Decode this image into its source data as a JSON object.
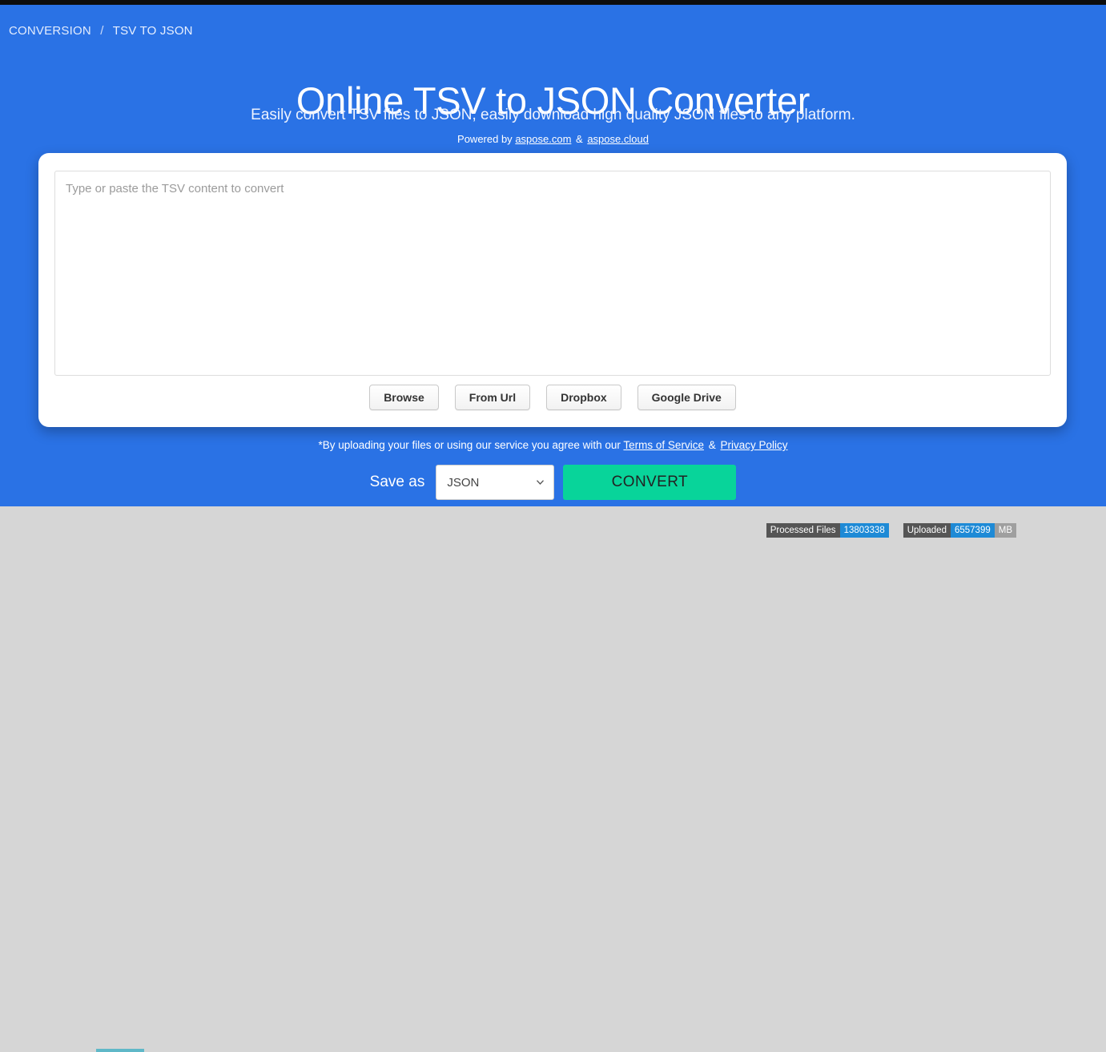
{
  "theme": {
    "hero_blue": "#2a72e5",
    "convert_green": "#08d49a",
    "badge_blue": "#1e8ad6",
    "top_strip": "#0d0d0d",
    "footer_gray": "#d6d6d6",
    "teal_accent": "#5fb8c8"
  },
  "breadcrumb": {
    "root": "CONVERSION",
    "separator": "/",
    "current": "TSV TO JSON"
  },
  "hero": {
    "title": "Online TSV to JSON Converter",
    "subtitle": "Easily convert TSV files to JSON, easily download high quality JSON files to any platform.",
    "powered_prefix": "Powered by",
    "powered_link_1": "aspose.com",
    "powered_amp": "&",
    "powered_link_2": "aspose.cloud"
  },
  "card": {
    "textarea_placeholder": "Type or paste the TSV content to convert",
    "textarea_value": "",
    "source_buttons": [
      {
        "label": "Browse",
        "name": "browse-button"
      },
      {
        "label": "From Url",
        "name": "from-url-button"
      },
      {
        "label": "Dropbox",
        "name": "dropbox-button"
      },
      {
        "label": "Google Drive",
        "name": "google-drive-button"
      }
    ]
  },
  "terms": {
    "prefix": "*By uploading your files or using our service you agree with our",
    "terms_link": "Terms of Service",
    "amp": "&",
    "privacy_link": "Privacy Policy"
  },
  "save_as": {
    "label": "Save as",
    "selected_format": "JSON",
    "options": [
      "JSON"
    ],
    "convert_label": "CONVERT",
    "dropdown_icon": "chevron-down-icon"
  },
  "footer": {
    "badges": [
      {
        "label": "Processed Files",
        "value": "13803338",
        "unit": ""
      },
      {
        "label": "Uploaded",
        "value": "6557399",
        "unit": "MB"
      }
    ]
  }
}
